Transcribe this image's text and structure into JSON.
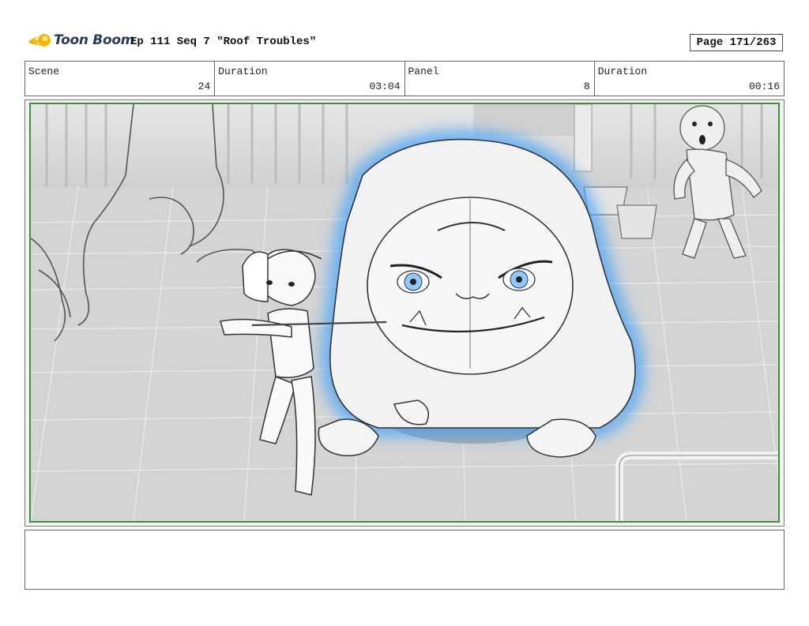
{
  "brand": {
    "name": "Toon Boom",
    "accent": "#f4b400",
    "text_color": "#2b3b55"
  },
  "header": {
    "title": "Ep 111 Seq 7 \"Roof Troubles\"",
    "page": "Page 171/263"
  },
  "info": {
    "scene_label": "Scene",
    "scene_value": "24",
    "scene_duration_label": "Duration",
    "scene_duration_value": "03:04",
    "panel_label": "Panel",
    "panel_value": "8",
    "panel_duration_label": "Duration",
    "panel_duration_value": "00:16"
  },
  "panel": {
    "frame_color": "#3f8f3f",
    "glow_color": "#3aa0ff",
    "eye_color": "#8fc8ff"
  },
  "notes": {
    "text": ""
  }
}
